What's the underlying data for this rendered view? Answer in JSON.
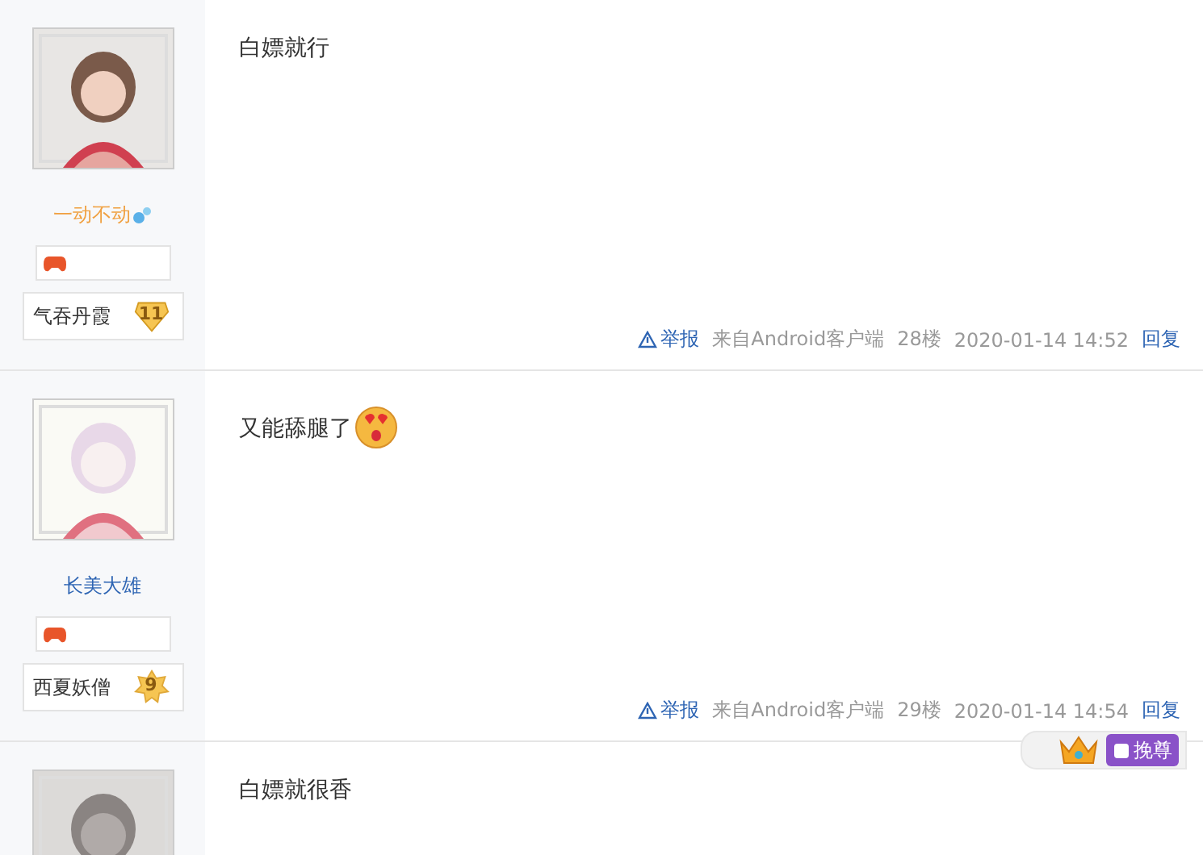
{
  "posts": [
    {
      "author": {
        "name": "一动不动",
        "color": "#f0a040",
        "vip": true
      },
      "level": {
        "title": "气吞丹霞",
        "number": "11",
        "kind": "shield"
      },
      "content": "白嫖就行",
      "emoji": false,
      "footer": {
        "report": "举报",
        "source": "来自Android客户端",
        "floor": "28楼",
        "time": "2020-01-14 14:52",
        "reply": "回复"
      }
    },
    {
      "author": {
        "name": "长美大雄",
        "color": "#2d64b3",
        "vip": false
      },
      "level": {
        "title": "西夏妖僧",
        "number": "9",
        "kind": "star"
      },
      "content": "又能舔腿了",
      "emoji": true,
      "footer": {
        "report": "举报",
        "source": "来自Android客户端",
        "floor": "29楼",
        "time": "2020-01-14 14:54",
        "reply": "回复"
      }
    },
    {
      "content": "白嫖就很香",
      "emoji": false
    }
  ],
  "floating_badge": {
    "label": "挽尊"
  }
}
